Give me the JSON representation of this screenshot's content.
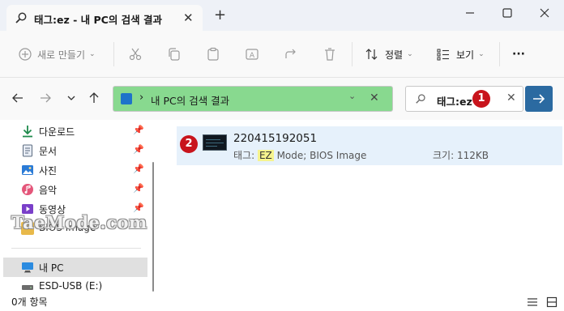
{
  "window": {
    "tab_title": "태그:ez - 내 PC의 검색 결과",
    "tab_close": "✕",
    "new_tab": "+"
  },
  "toolbar": {
    "new_label": "새로 만들기",
    "sort_label": "정렬",
    "view_label": "보기",
    "more_label": "···"
  },
  "address": {
    "separator": "›",
    "path": "내 PC의 검색 결과",
    "dropdown": "⌄",
    "close": "✕"
  },
  "search": {
    "query": "태그:ez",
    "clear": "✕"
  },
  "markers": [
    "1",
    "2"
  ],
  "sidebar": {
    "items": [
      {
        "label": "다운로드",
        "icon": "download-icon",
        "pinned": true
      },
      {
        "label": "문서",
        "icon": "document-icon",
        "pinned": true
      },
      {
        "label": "사진",
        "icon": "picture-icon",
        "pinned": true
      },
      {
        "label": "음악",
        "icon": "music-icon",
        "pinned": true
      },
      {
        "label": "동영상",
        "icon": "video-icon",
        "pinned": true
      },
      {
        "label": "BIOS Image",
        "icon": "folder-icon",
        "pinned": false
      },
      {
        "label": "내 PC",
        "icon": "pc-icon",
        "pinned": false
      },
      {
        "label": "ESD-USB (E:)",
        "icon": "drive-icon",
        "pinned": false
      }
    ],
    "pin_glyph": "📌"
  },
  "results": [
    {
      "name": "220415192051",
      "tag_prefix": "태그: ",
      "tag_highlight": "EZ",
      "tag_rest": " Mode; BIOS Image",
      "size": "크기: 112KB"
    }
  ],
  "status": {
    "count_text": "0개 항목"
  },
  "watermark": "TaeMode.com",
  "colors": {
    "address_bg": "#88d98f",
    "accent": "#2b6aa1",
    "marker": "#c8141c",
    "selection": "#e6f1fb",
    "highlight": "#f6f48e"
  }
}
